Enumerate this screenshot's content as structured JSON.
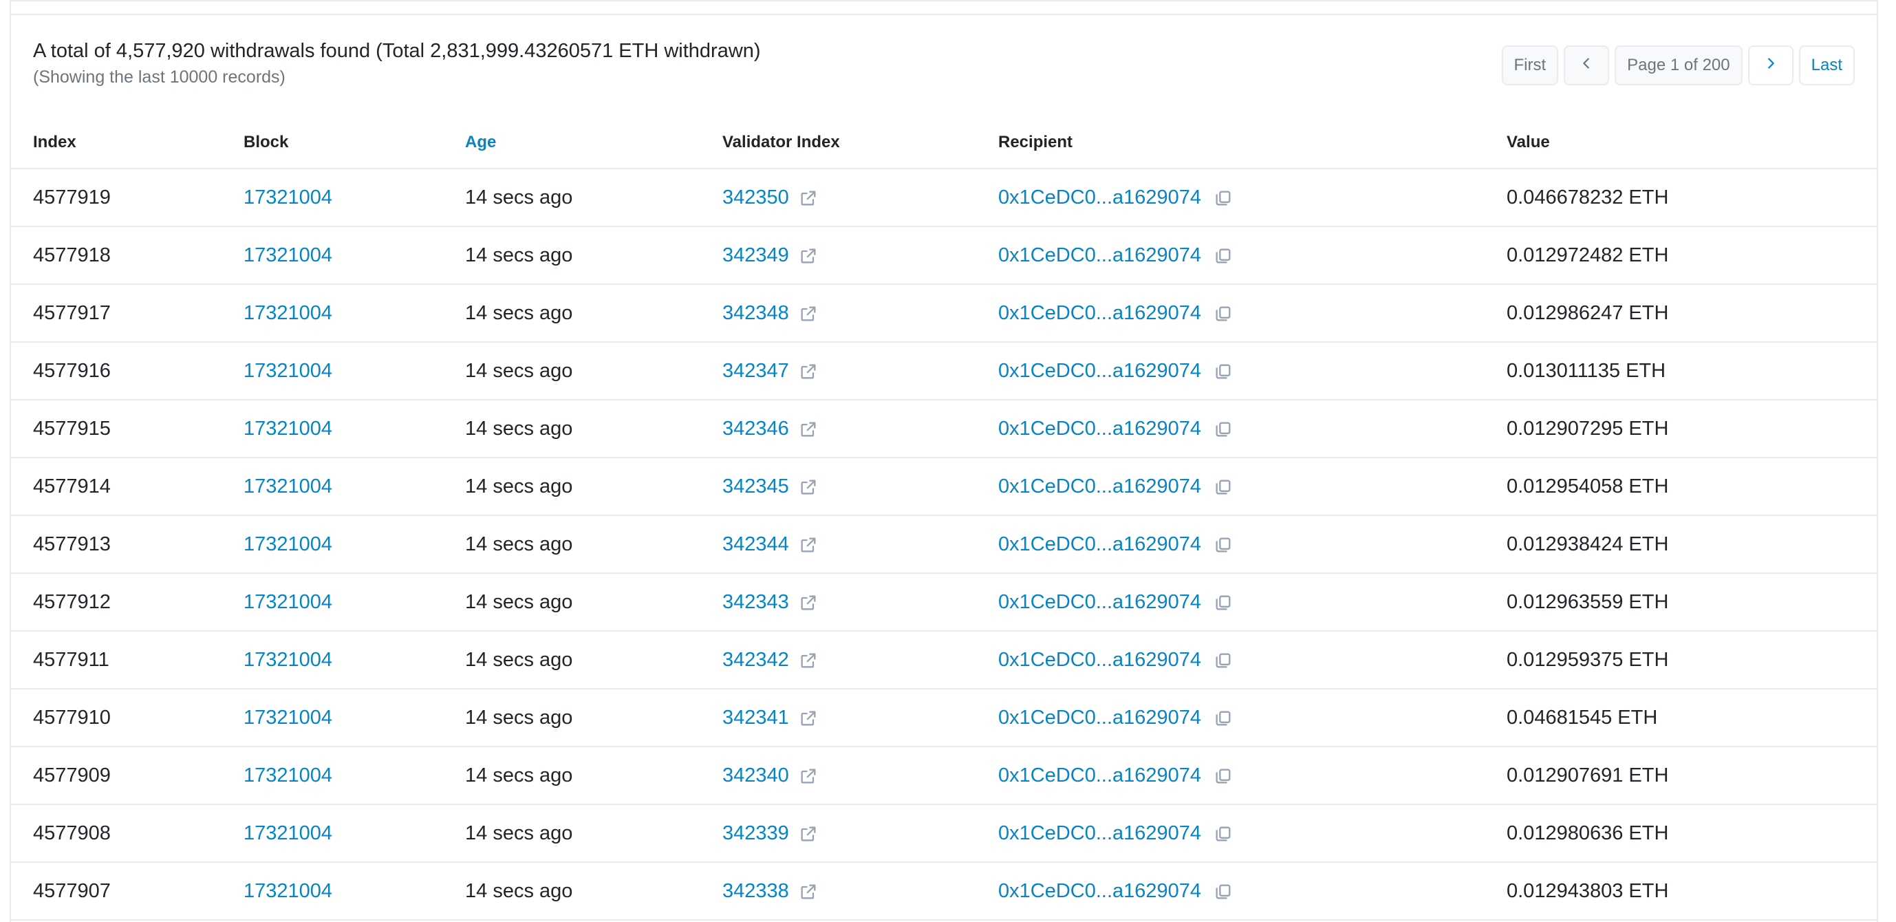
{
  "summary": {
    "total_text": "A total of 4,577,920 withdrawals found (Total 2,831,999.43260571 ETH withdrawn)",
    "sub_text": "(Showing the last 10000 records)"
  },
  "pager": {
    "first": "First",
    "page_info": "Page 1 of 200",
    "last": "Last"
  },
  "table": {
    "headers": [
      "Index",
      "Block",
      "Age",
      "Validator Index",
      "Recipient",
      "Value"
    ],
    "rows": [
      {
        "index": "4577919",
        "block": "17321004",
        "age": "14 secs ago",
        "validator": "342350",
        "recipient": "0x1CeDC0...a1629074",
        "value": "0.046678232 ETH"
      },
      {
        "index": "4577918",
        "block": "17321004",
        "age": "14 secs ago",
        "validator": "342349",
        "recipient": "0x1CeDC0...a1629074",
        "value": "0.012972482 ETH"
      },
      {
        "index": "4577917",
        "block": "17321004",
        "age": "14 secs ago",
        "validator": "342348",
        "recipient": "0x1CeDC0...a1629074",
        "value": "0.012986247 ETH"
      },
      {
        "index": "4577916",
        "block": "17321004",
        "age": "14 secs ago",
        "validator": "342347",
        "recipient": "0x1CeDC0...a1629074",
        "value": "0.013011135 ETH"
      },
      {
        "index": "4577915",
        "block": "17321004",
        "age": "14 secs ago",
        "validator": "342346",
        "recipient": "0x1CeDC0...a1629074",
        "value": "0.012907295 ETH"
      },
      {
        "index": "4577914",
        "block": "17321004",
        "age": "14 secs ago",
        "validator": "342345",
        "recipient": "0x1CeDC0...a1629074",
        "value": "0.012954058 ETH"
      },
      {
        "index": "4577913",
        "block": "17321004",
        "age": "14 secs ago",
        "validator": "342344",
        "recipient": "0x1CeDC0...a1629074",
        "value": "0.012938424 ETH"
      },
      {
        "index": "4577912",
        "block": "17321004",
        "age": "14 secs ago",
        "validator": "342343",
        "recipient": "0x1CeDC0...a1629074",
        "value": "0.012963559 ETH"
      },
      {
        "index": "4577911",
        "block": "17321004",
        "age": "14 secs ago",
        "validator": "342342",
        "recipient": "0x1CeDC0...a1629074",
        "value": "0.012959375 ETH"
      },
      {
        "index": "4577910",
        "block": "17321004",
        "age": "14 secs ago",
        "validator": "342341",
        "recipient": "0x1CeDC0...a1629074",
        "value": "0.04681545 ETH"
      },
      {
        "index": "4577909",
        "block": "17321004",
        "age": "14 secs ago",
        "validator": "342340",
        "recipient": "0x1CeDC0...a1629074",
        "value": "0.012907691 ETH"
      },
      {
        "index": "4577908",
        "block": "17321004",
        "age": "14 secs ago",
        "validator": "342339",
        "recipient": "0x1CeDC0...a1629074",
        "value": "0.012980636 ETH"
      },
      {
        "index": "4577907",
        "block": "17321004",
        "age": "14 secs ago",
        "validator": "342338",
        "recipient": "0x1CeDC0...a1629074",
        "value": "0.012943803 ETH"
      }
    ]
  },
  "colors": {
    "link": "#0784c3",
    "text": "#212529",
    "muted": "#6c757d",
    "border": "#e9ecef"
  },
  "icons": {
    "validator_link": "external-link-icon",
    "recipient_copy": "copy-icon",
    "prev": "chevron-left-icon",
    "next": "chevron-right-icon"
  }
}
